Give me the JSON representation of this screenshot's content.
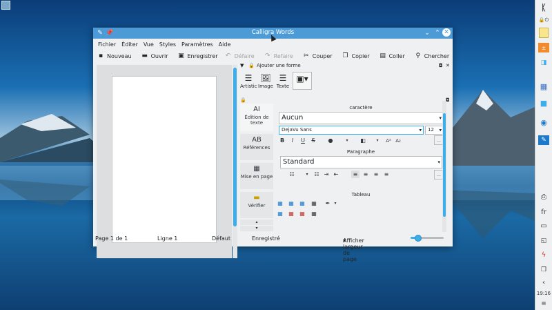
{
  "window": {
    "title": "Calligra Words",
    "accent": "#4d9bd6"
  },
  "menu": [
    "Fichier",
    "Éditer",
    "Vue",
    "Styles",
    "Paramètres",
    "Aide"
  ],
  "toolbar": [
    {
      "label": "Nouveau",
      "icon": "new-document-icon",
      "enabled": true
    },
    {
      "label": "Ouvrir",
      "icon": "folder-open-icon",
      "enabled": true
    },
    {
      "label": "Enregistrer",
      "icon": "save-icon",
      "enabled": true
    },
    {
      "label": "Défaire",
      "icon": "undo-icon",
      "enabled": false
    },
    {
      "label": "Refaire",
      "icon": "redo-icon",
      "enabled": false
    },
    {
      "label": "Couper",
      "icon": "scissors-icon",
      "enabled": true
    },
    {
      "label": "Copier",
      "icon": "copy-icon",
      "enabled": true
    },
    {
      "label": "Coller",
      "icon": "paste-icon",
      "enabled": true
    },
    {
      "label": "Chercher",
      "icon": "search-icon",
      "enabled": true
    }
  ],
  "shape_docker": {
    "title": "Ajouter une forme",
    "items": [
      "Artistic",
      "Image",
      "Texte"
    ]
  },
  "side_tabs": [
    "Édition de texte",
    "Références",
    "Mise en page",
    "Vérifier"
  ],
  "props": {
    "caractere_title": "caractère",
    "style_value": "Aucun",
    "font_value": "DejaVu Sans",
    "size_value": "12",
    "paragraphe_title": "Paragraphe",
    "para_style_value": "Standard",
    "tableau_title": "Tableau"
  },
  "status": {
    "page": "Page 1 de 1",
    "line": "Ligne 1",
    "style": "Défaut",
    "saved": "Enregistré",
    "zoom_label": "Afficher largeur de page",
    "zoom_level": 0.2
  },
  "panel": {
    "lang": "fr",
    "clock": "19:16"
  }
}
